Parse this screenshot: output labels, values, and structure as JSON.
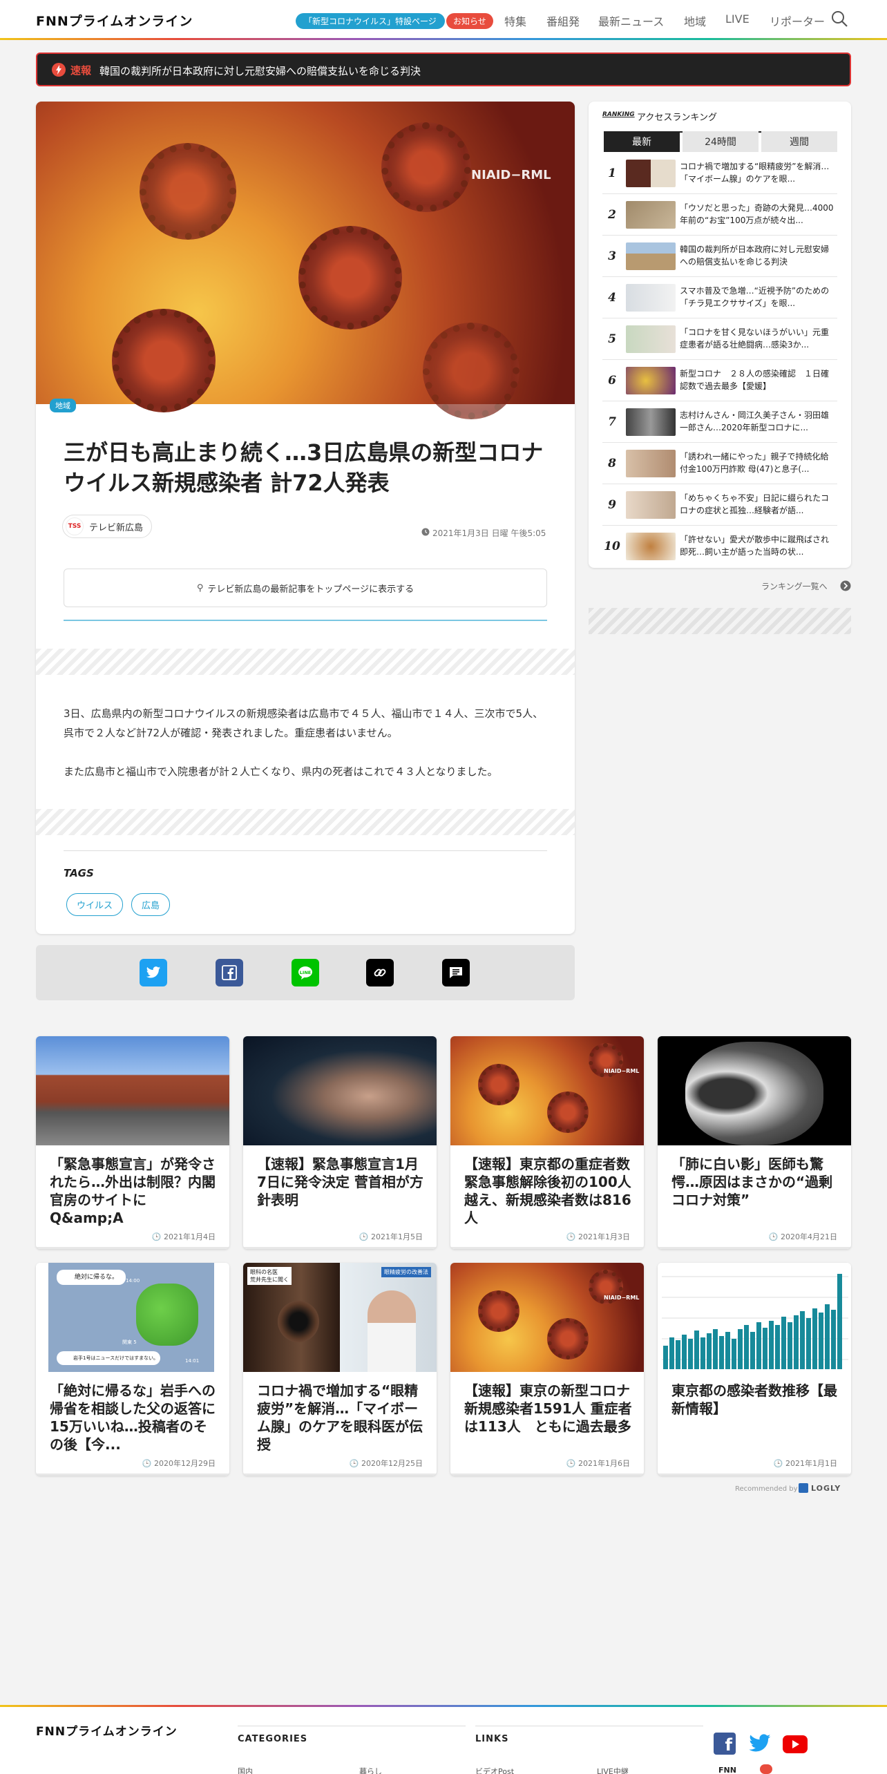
{
  "header": {
    "logo": "FNNプライムオンライン",
    "pill_corona": "「新型コロナウイルス」特設ページ",
    "pill_notice": "お知らせ",
    "nav": [
      "特集",
      "番組発",
      "最新ニュース",
      "地域",
      "LIVE",
      "リポーター"
    ]
  },
  "breaking": {
    "label": "速報",
    "text": "韓国の裁判所が日本政府に対し元慰安婦への賠償支払いを命じる判決"
  },
  "article": {
    "image_caption": "NIAID−RML",
    "category": "地域",
    "title": "三が日も高止まり続く…3日広島県の新型コロナウイルス新規感染者 計72人発表",
    "source_badge": "TSS",
    "source": "テレビ新広島",
    "date": "2021年1月3日 日曜 午後5:05",
    "pin_button": "テレビ新広島の最新記事をトップページに表示する",
    "body": [
      "3日、広島県内の新型コロナウイルスの新規感染者は広島市で４５人、福山市で１４人、三次市で5人、呉市で２人など計72人が確認・発表されました。重症患者はいません。",
      "また広島市と福山市で入院患者が計２人亡くなり、県内の死者はこれで４３人となりました。"
    ],
    "tags_heading": "TAGS",
    "tags": [
      "ウイルス",
      "広島"
    ]
  },
  "share": [
    "twitter",
    "facebook",
    "line",
    "copy-link",
    "comment"
  ],
  "ranking": {
    "heading_label": "RANKING",
    "heading": "アクセスランキング",
    "tabs": [
      "最新",
      "24時間",
      "週間"
    ],
    "items": [
      {
        "rank": "1",
        "text": "コロナ禍で増加する“眼精疲労”を解消…「マイボーム腺」のケアを眼..."
      },
      {
        "rank": "2",
        "text": "「ウソだと思った」奇跡の大発見…4000年前の“お宝”100万点が続々出..."
      },
      {
        "rank": "3",
        "text": "韓国の裁判所が日本政府に対し元慰安婦への賠償支払いを命じる判決"
      },
      {
        "rank": "4",
        "text": "スマホ普及で急増…“近視予防”のための「チラ見エクササイズ」を眼..."
      },
      {
        "rank": "5",
        "text": "「コロナを甘く見ないほうがいい」元重症患者が語る壮絶闘病…感染3か..."
      },
      {
        "rank": "6",
        "text": "新型コロナ　２８人の感染確認　１日確認数で過去最多【愛媛】"
      },
      {
        "rank": "7",
        "text": "志村けんさん・岡江久美子さん・羽田雄一郎さん…2020年新型コロナに..."
      },
      {
        "rank": "8",
        "text": "「誘われ一緒にやった」親子で持続化給付金100万円詐欺 母(47)と息子(..."
      },
      {
        "rank": "9",
        "text": "「めちゃくちゃ不安」日記に綴られたコロナの症状と孤独…経験者が語..."
      },
      {
        "rank": "10",
        "text": "「許せない」愛犬が散歩中に蹴飛ばされ即死…飼い主が語った当時の状..."
      }
    ],
    "more": "ランキング一覧へ"
  },
  "cards": [
    {
      "title": "「緊急事態宣言」が発令されたら…外出は制限？内閣官房のサイトにQ&amp;A",
      "date": "2021年1月4日"
    },
    {
      "title": "【速報】緊急事態宣言1月7日に発令決定 菅首相が方針表明",
      "date": "2021年1月5日"
    },
    {
      "title": "【速報】東京都の重症者数 緊急事態解除後初の100人越え、新規感染者数は816人",
      "date": "2021年1月3日"
    },
    {
      "title": "「肺に白い影」医師も驚愕…原因はまさかの“過剰コロナ対策”",
      "date": "2020年4月21日"
    },
    {
      "title": "「絶対に帰るな」岩手への帰省を相談した父の返答に15万いいね…投稿者のその後【今...",
      "date": "2020年12月29日"
    },
    {
      "title": "コロナ禍で増加する“眼精疲労”を解消…「マイボーム腺」のケアを眼科医が伝授",
      "date": "2020年12月25日"
    },
    {
      "title": "【速報】東京の新型コロナ新規感染者1591人 重症者は113人　ともに過去最多",
      "date": "2021年1月6日"
    },
    {
      "title": "東京都の感染者数推移【最新情報】",
      "date": "2021年1月1日"
    }
  ],
  "card_image_text": {
    "niaid": "NIAID−RML",
    "line_msg1": "絶対に帰るな。",
    "line_time1": "14:00",
    "line_msg2": "岩手1号はニュースだけではすまない。",
    "line_time2": "14:01",
    "line_mid": "関東 5",
    "eye_label1": "眼科の名医",
    "eye_label2": "荒井先生に聞く",
    "eye_label3": "眼精疲労の改善法"
  },
  "recommended": {
    "prefix": "Recommended by",
    "brand": "LOGLY"
  },
  "footer": {
    "logo": "FNNプライムオンライン",
    "categories": "CATEGORIES",
    "links": "LINKS",
    "cat_items": [
      "国内",
      "暮らし"
    ],
    "link_items": [
      "ビデオPost",
      "LIVE中継"
    ],
    "fnn_mark": "FNN"
  }
}
